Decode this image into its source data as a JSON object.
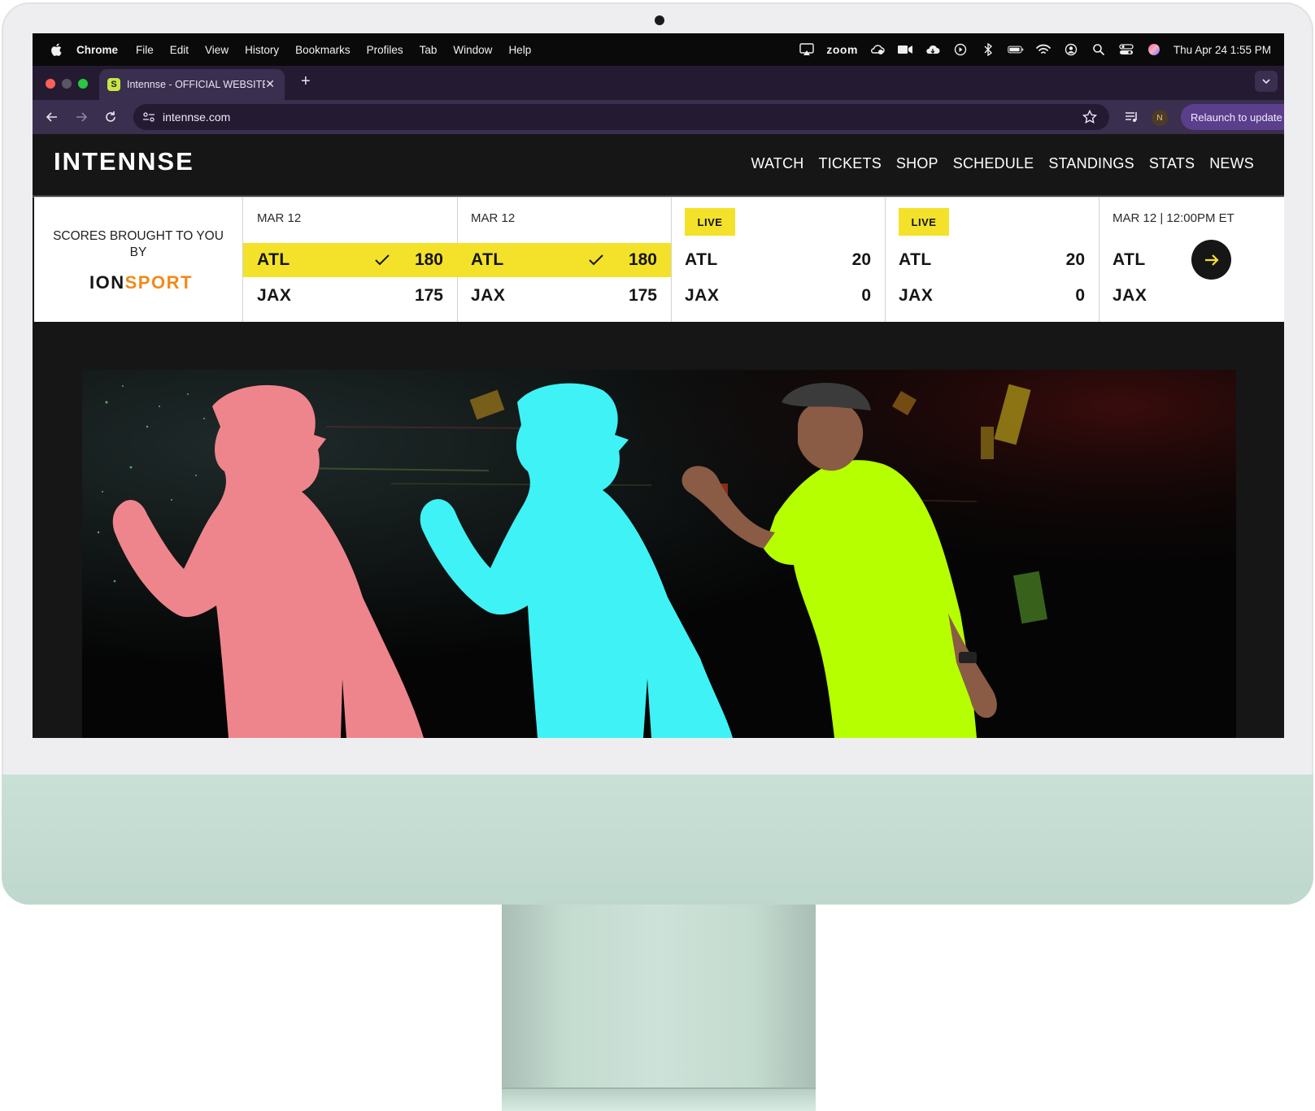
{
  "menubar": {
    "app": "Chrome",
    "items": [
      "File",
      "Edit",
      "View",
      "History",
      "Bookmarks",
      "Profiles",
      "Tab",
      "Window",
      "Help"
    ],
    "status_zoom": "zoom",
    "clock": "Thu Apr 24  1:55 PM"
  },
  "browser": {
    "tab_title": "Intennse - OFFICIAL WEBSITE",
    "favicon_letter": "S",
    "url": "intennse.com",
    "profile_initial": "N",
    "relaunch_label": "Relaunch to update"
  },
  "site": {
    "logo": "INTENNSE",
    "nav": [
      "WATCH",
      "TICKETS",
      "SHOP",
      "SCHEDULE",
      "STANDINGS",
      "STATS",
      "NEWS"
    ]
  },
  "scores": {
    "sponsor_text": "SCORES BROUGHT TO YOU BY",
    "sponsor_logo_a": "ION",
    "sponsor_logo_b": "SPORT",
    "games": [
      {
        "label": "MAR 12",
        "live": false,
        "teams": [
          {
            "name": "ATL",
            "score": "180",
            "winner": true
          },
          {
            "name": "JAX",
            "score": "175",
            "winner": false
          }
        ]
      },
      {
        "label": "MAR 12",
        "live": false,
        "teams": [
          {
            "name": "ATL",
            "score": "180",
            "winner": true
          },
          {
            "name": "JAX",
            "score": "175",
            "winner": false
          }
        ]
      },
      {
        "label": "LIVE",
        "live": true,
        "teams": [
          {
            "name": "ATL",
            "score": "20",
            "winner": false
          },
          {
            "name": "JAX",
            "score": "0",
            "winner": false
          }
        ]
      },
      {
        "label": "LIVE",
        "live": true,
        "teams": [
          {
            "name": "ATL",
            "score": "20",
            "winner": false
          },
          {
            "name": "JAX",
            "score": "0",
            "winner": false
          }
        ]
      },
      {
        "label": "MAR 12 | 12:00PM ET",
        "live": false,
        "teams": [
          {
            "name": "ATL",
            "score": "",
            "winner": false
          },
          {
            "name": "JAX",
            "score": "",
            "winner": false
          }
        ]
      }
    ]
  },
  "colors": {
    "accent_yellow": "#f4e22a",
    "silhouette_pink": "#ef858c",
    "silhouette_cyan": "#3ff2f5",
    "shirt_lime": "#b5ff00",
    "browser_purple": "#3a2f4e",
    "sponsor_orange": "#f08a1a"
  }
}
